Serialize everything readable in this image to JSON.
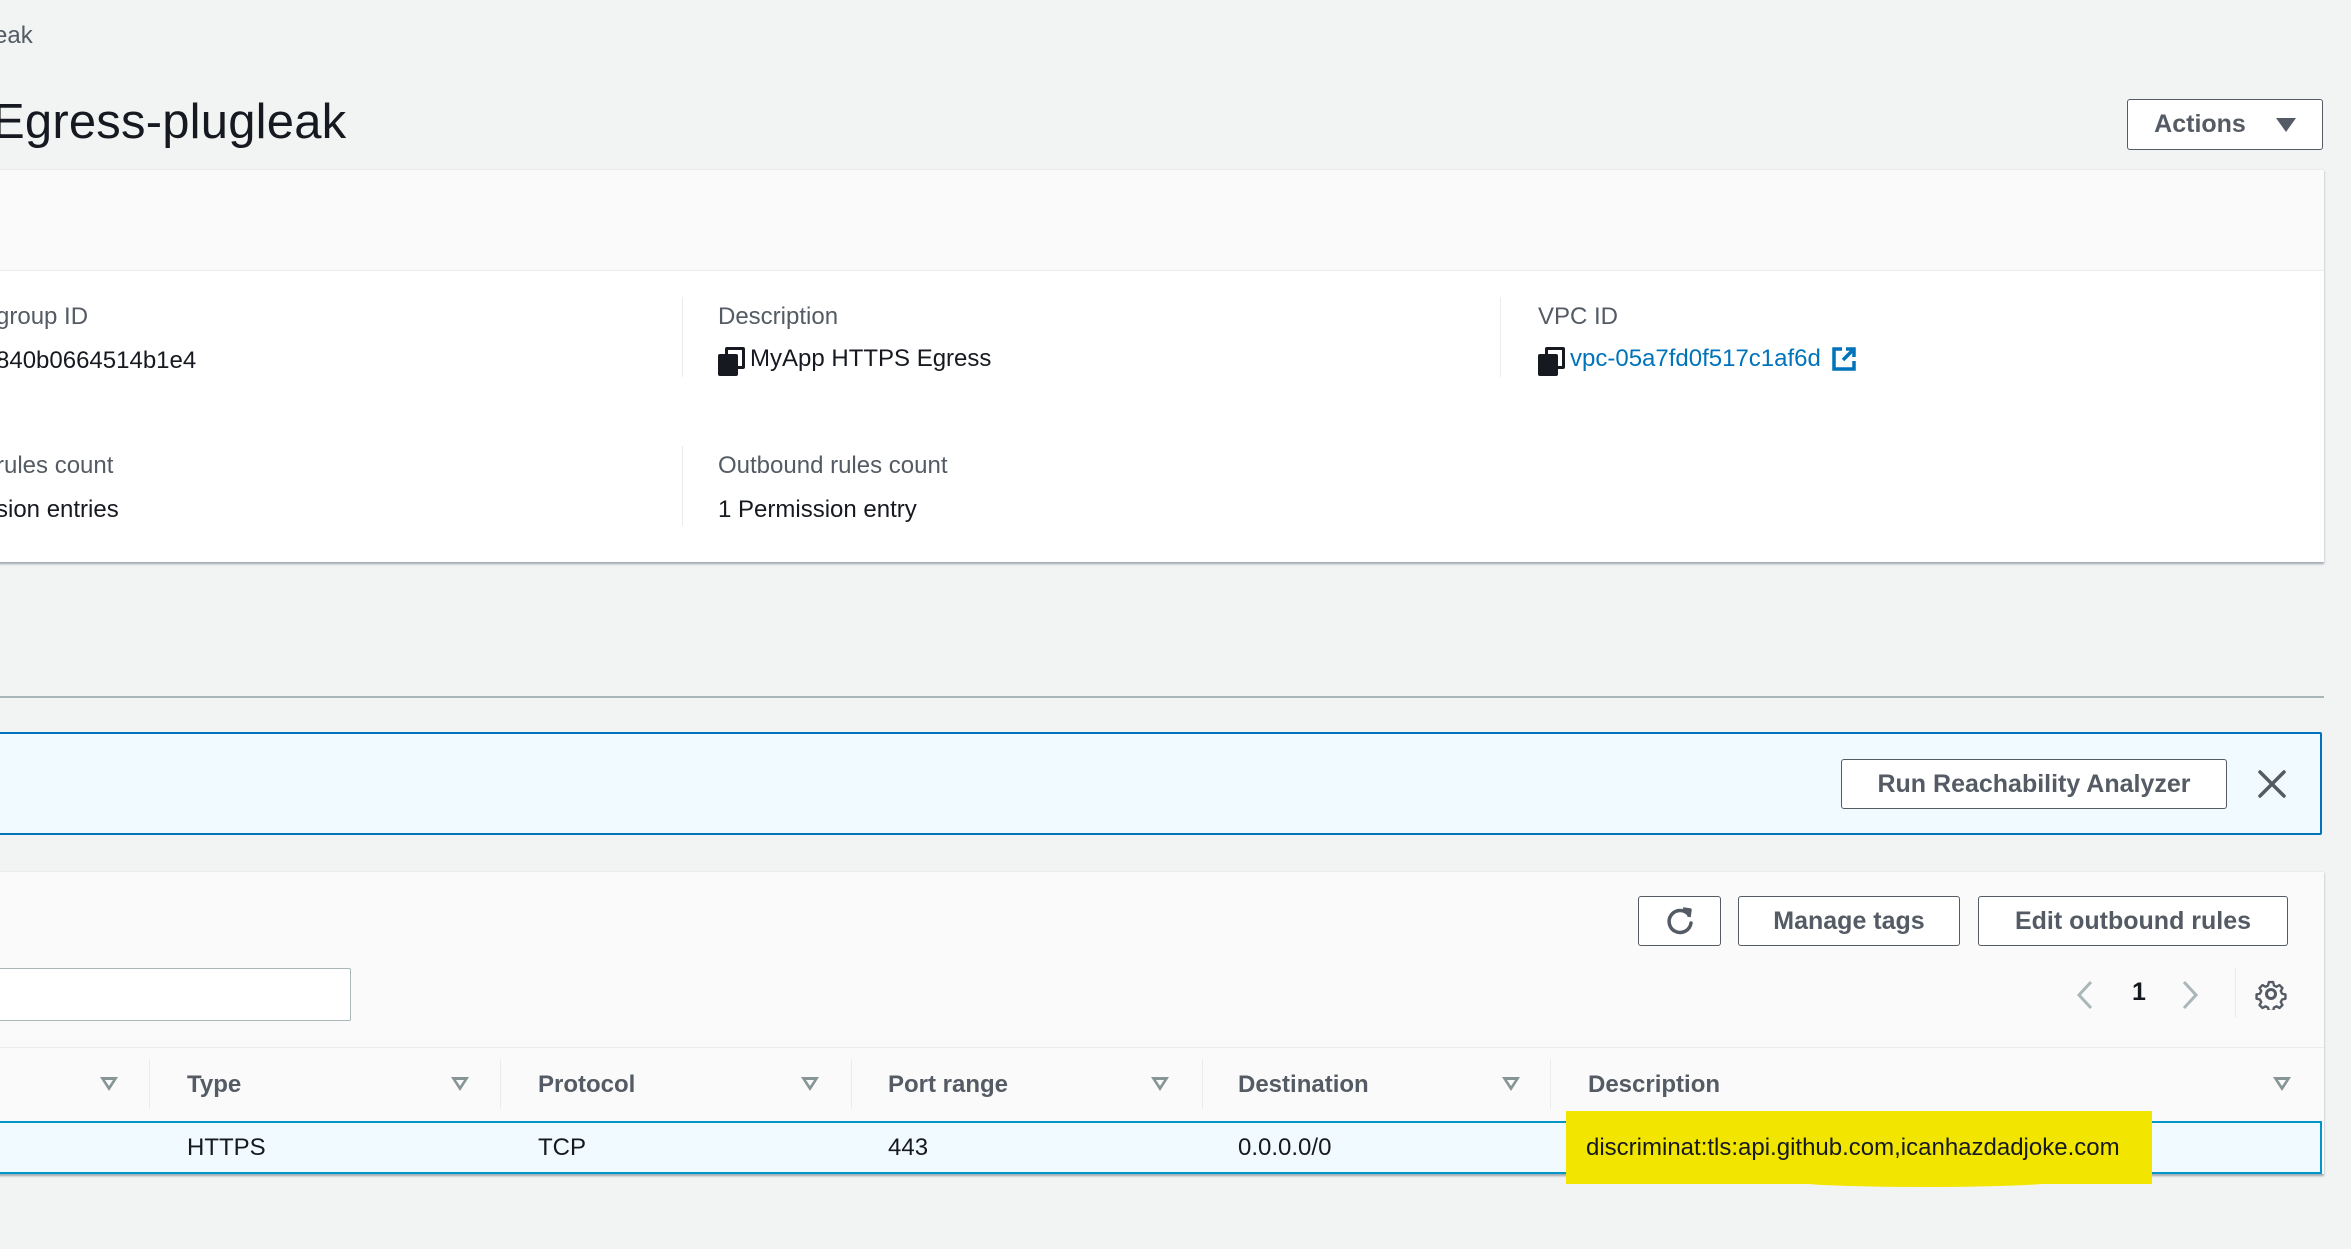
{
  "breadcrumb": {
    "current": "eak"
  },
  "header": {
    "title": "Egress-plugleak",
    "actions_label": "Actions"
  },
  "details": {
    "group_id": {
      "label": "group ID",
      "value": "840b0664514b1e4"
    },
    "description": {
      "label": "Description",
      "value": "MyApp HTTPS Egress"
    },
    "vpc_id": {
      "label": "VPC ID",
      "value": "vpc-05a7fd0f517c1af6d"
    },
    "inbound_rules_count": {
      "label": "rules count",
      "value": "sion entries"
    },
    "outbound_rules_count": {
      "label": "Outbound rules count",
      "value": "1 Permission entry"
    }
  },
  "banner": {
    "run_reachability_label": "Run Reachability Analyzer",
    "close_icon": "close-icon"
  },
  "rules_toolbar": {
    "refresh_icon": "refresh-icon",
    "manage_tags_label": "Manage tags",
    "edit_outbound_label": "Edit outbound rules",
    "search_value": "",
    "search_placeholder": "",
    "current_page": "1",
    "settings_icon": "gear-icon"
  },
  "table": {
    "columns": [
      "",
      "Type",
      "Protocol",
      "Port range",
      "Destination",
      "Description"
    ],
    "rows": [
      {
        "name": "",
        "type": "HTTPS",
        "protocol": "TCP",
        "port_range": "443",
        "destination": "0.0.0.0/0",
        "description": "discriminat:tls:api.github.com,icanhazdadjoke.com"
      }
    ]
  },
  "colors": {
    "page_bg": "#f2f3f3",
    "link": "#0073bb",
    "banner_border": "#0073bb",
    "banner_bg": "#f1faff",
    "selected_row_border": "#0096c7",
    "highlight": "#f2e500",
    "button_text": "#545b64"
  }
}
